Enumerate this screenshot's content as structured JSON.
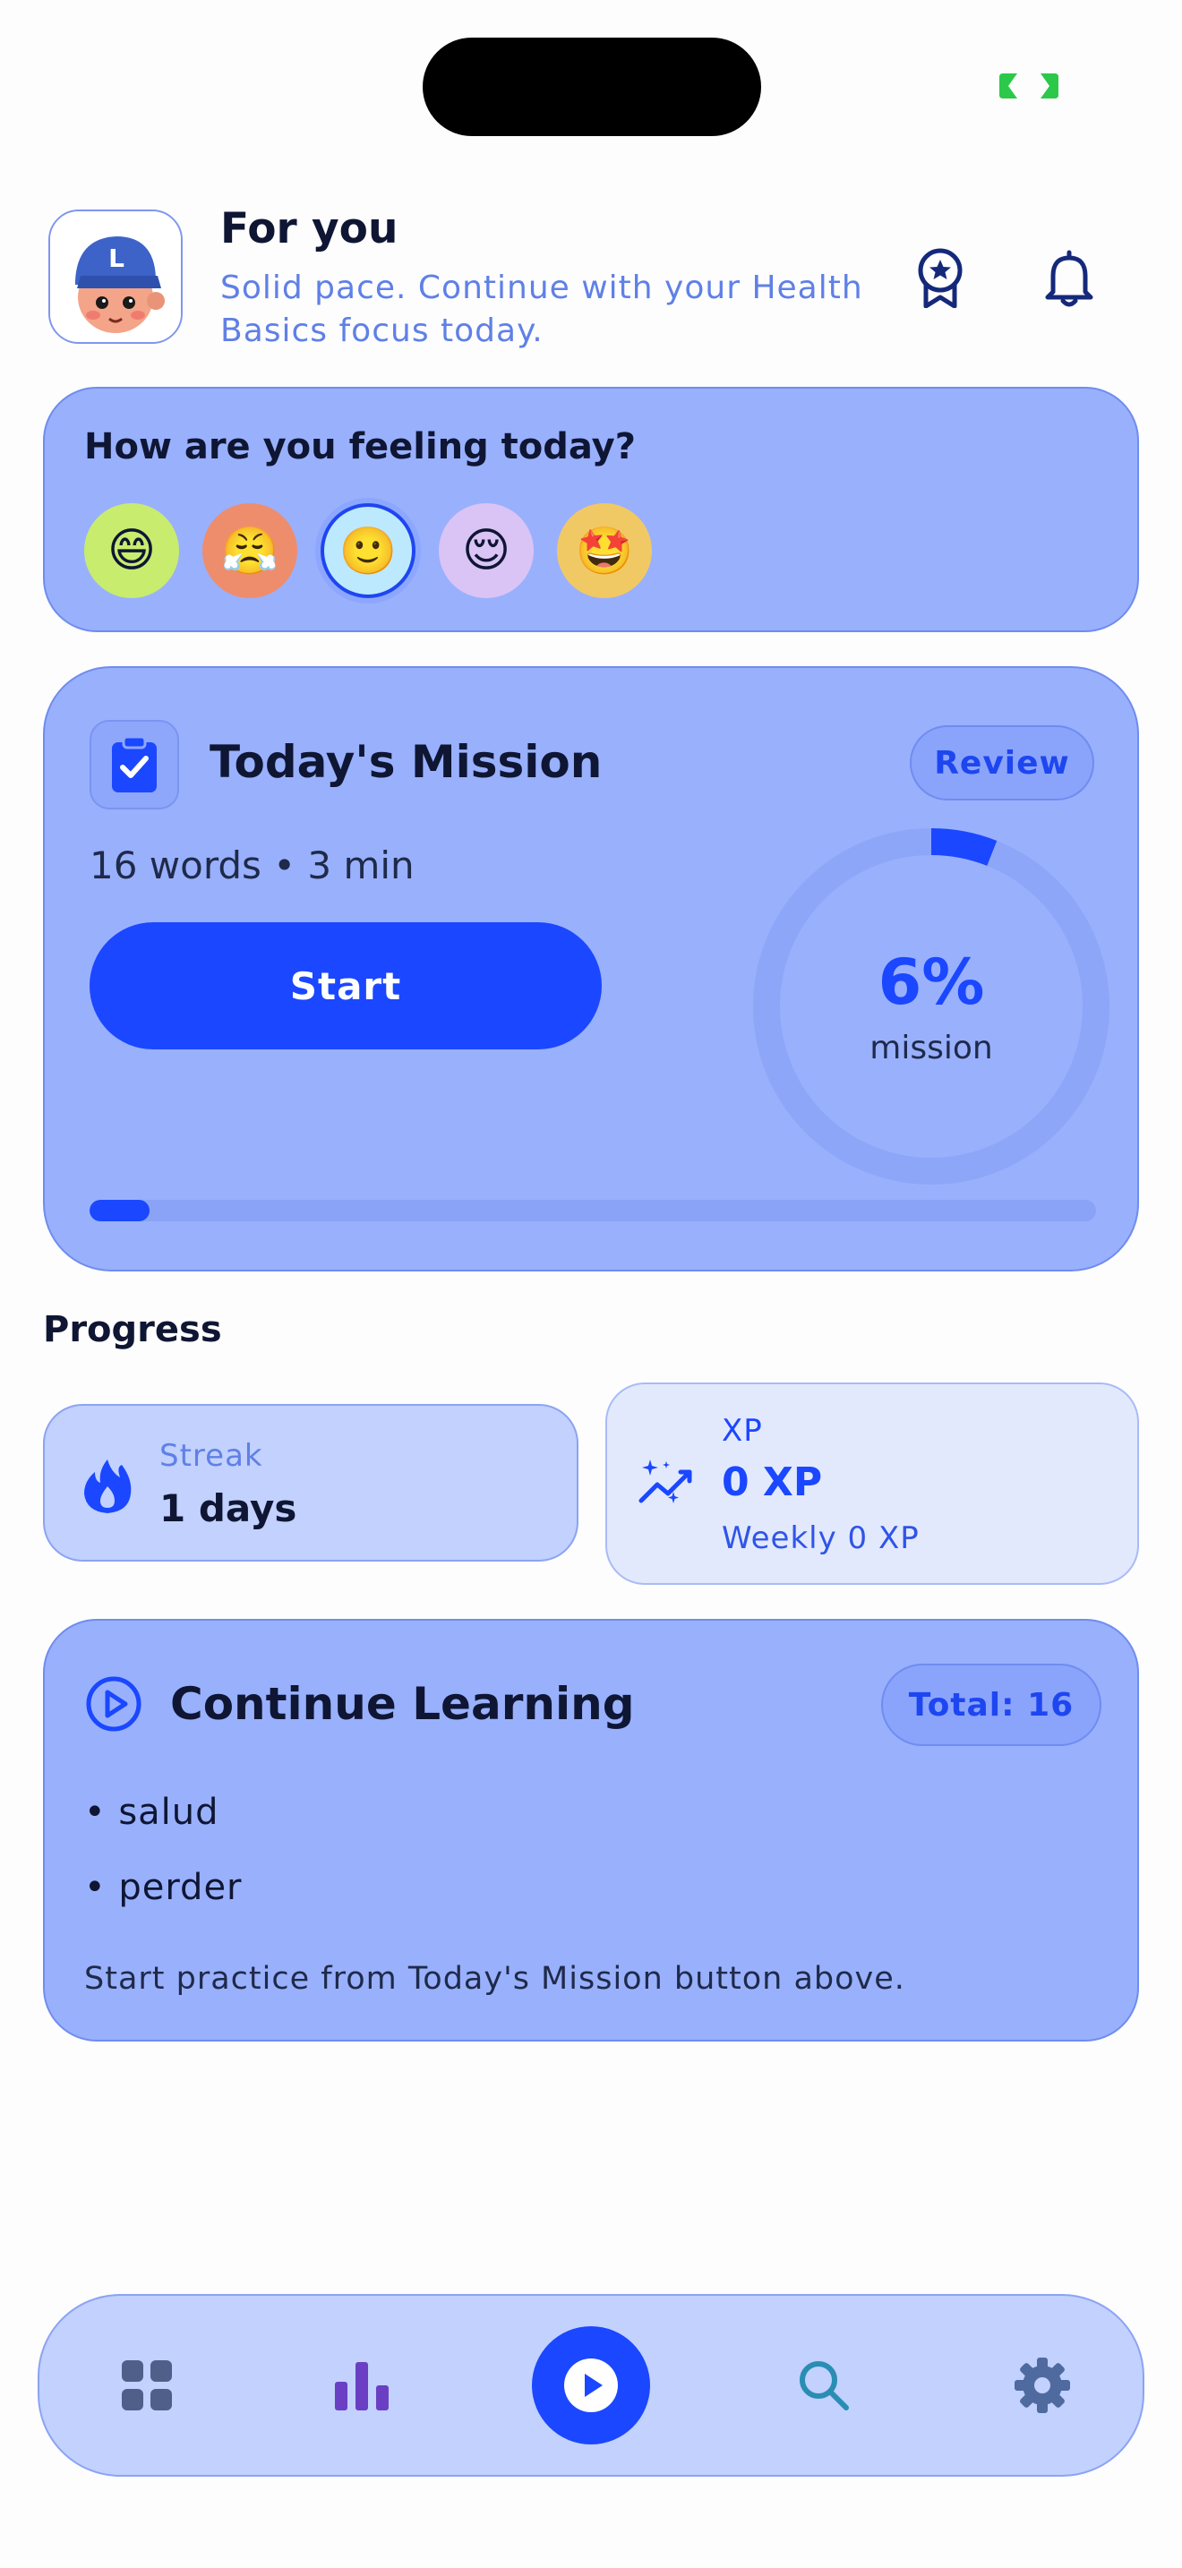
{
  "header": {
    "title": "For you",
    "subtitle": "Solid pace. Continue with your Health Basics focus today.",
    "icons": [
      "avatar",
      "award-icon",
      "bell-icon"
    ]
  },
  "mood": {
    "question": "How are you feeling today?",
    "options": [
      {
        "emoji": "😄",
        "color": "#c8ec6e"
      },
      {
        "emoji": "😤",
        "color": "#ee8d6c"
      },
      {
        "emoji": "🙂",
        "color": "#bde9ff",
        "selected": true
      },
      {
        "emoji": "😌",
        "color": "#d9c4f5"
      },
      {
        "emoji": "🤩",
        "color": "#f1c964"
      }
    ]
  },
  "mission": {
    "title": "Today's Mission",
    "review_label": "Review",
    "meta": "16 words • 3 min",
    "start_label": "Start",
    "percent_text": "6%",
    "percent_label": "mission",
    "progress": 0.06
  },
  "progress": {
    "heading": "Progress",
    "streak_label": "Streak",
    "streak_value": "1 days",
    "xp_label": "XP",
    "xp_value": "0 XP",
    "xp_weekly": "Weekly 0 XP"
  },
  "learning": {
    "title": "Continue Learning",
    "total_label": "Total: 16",
    "words": [
      "salud",
      "perder"
    ],
    "note": "Start practice from Today's Mission button above."
  },
  "nav": {
    "items": [
      "grid-icon",
      "stats-icon",
      "play-icon",
      "search-icon",
      "settings-icon"
    ],
    "active": "play-icon"
  },
  "colors": {
    "accent": "#1a47ff",
    "card": "#99b0fd",
    "subtle_card": "#c2d1fd",
    "status_green": "#2cc84a"
  }
}
